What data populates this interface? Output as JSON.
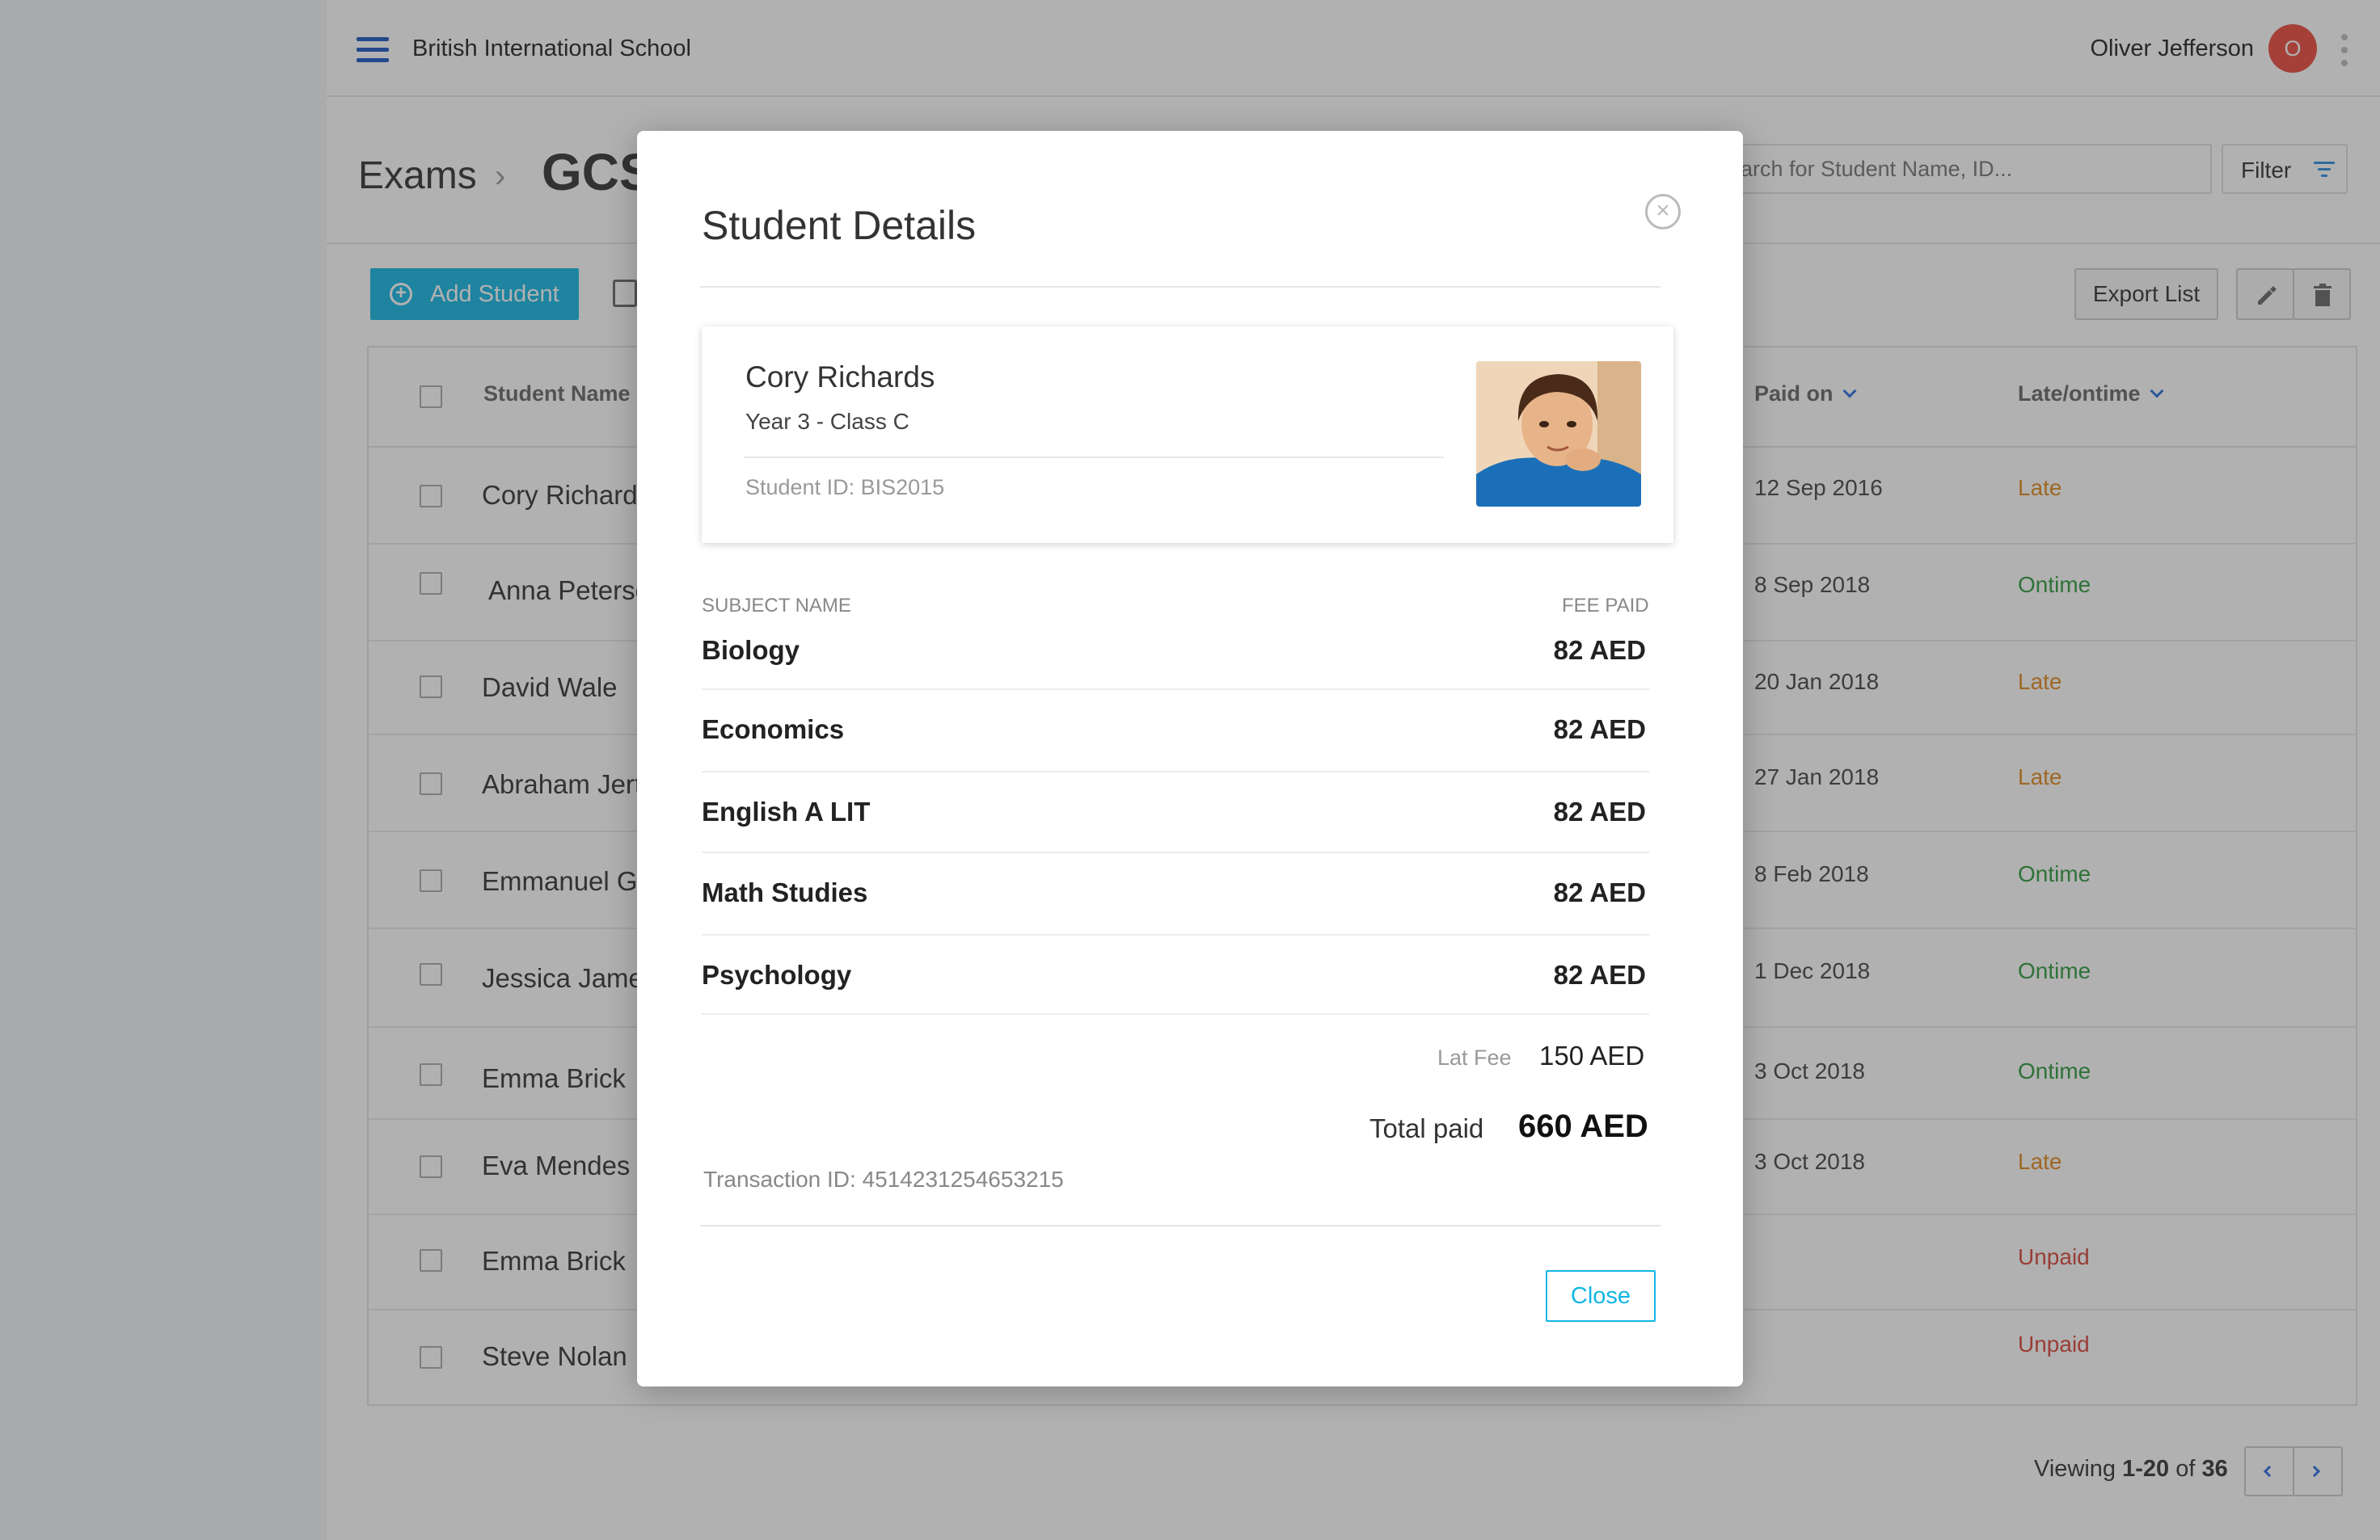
{
  "app": {
    "school_name": "British International School",
    "user_name": "Oliver Jefferson",
    "user_initial": "O"
  },
  "breadcrumb": {
    "root": "Exams",
    "current": "GCSE"
  },
  "search": {
    "placeholder": "Search for Student Name, ID..."
  },
  "toolbar": {
    "add_student": "Add Student",
    "filter": "Filter",
    "export_list": "Export List"
  },
  "table": {
    "columns": {
      "student_name": "Student Name",
      "paid_on": "Paid on",
      "late_ontime": "Late/ontime"
    },
    "rows": [
      {
        "name": "Cory Richards",
        "paid_on": "12 Sep 2016",
        "status": "Late"
      },
      {
        "name": "Anna Peterson",
        "paid_on": "8 Sep 2018",
        "status": "Ontime"
      },
      {
        "name": "David Wale",
        "paid_on": "20 Jan 2018",
        "status": "Late"
      },
      {
        "name": "Abraham Jert",
        "paid_on": "27 Jan 2018",
        "status": "Late"
      },
      {
        "name": "Emmanuel Go",
        "paid_on": "8 Feb 2018",
        "status": "Ontime"
      },
      {
        "name": "Jessica James",
        "paid_on": "1 Dec 2018",
        "status": "Ontime"
      },
      {
        "name": "Emma Brick",
        "paid_on": "3 Oct 2018",
        "status": "Ontime"
      },
      {
        "name": "Eva Mendes",
        "paid_on": "3 Oct 2018",
        "status": "Late"
      },
      {
        "name": "Emma Brick",
        "paid_on": "",
        "status": "Unpaid"
      },
      {
        "name": "Steve Nolan",
        "paid_on": "",
        "status": "Unpaid"
      }
    ]
  },
  "pagination": {
    "prefix": "Viewing ",
    "range": "1-20",
    "of": " of ",
    "total": "36"
  },
  "modal": {
    "title": "Student Details",
    "student": {
      "name": "Cory Richards",
      "class": "Year 3 - Class C",
      "student_id": "Student ID: BIS2015"
    },
    "subject_header": "SUBJECT NAME",
    "fee_header": "FEE PAID",
    "subjects": [
      {
        "name": "Biology",
        "fee": "82 AED"
      },
      {
        "name": "Economics",
        "fee": "82 AED"
      },
      {
        "name": "English A LIT",
        "fee": "82 AED"
      },
      {
        "name": "Math Studies",
        "fee": "82 AED"
      },
      {
        "name": "Psychology",
        "fee": "82 AED"
      }
    ],
    "late_fee_label": "Lat Fee",
    "late_fee_value": "150 AED",
    "total_label": "Total paid",
    "total_value": "660 AED",
    "transaction": "Transaction ID: 4514231254653215",
    "close": "Close"
  },
  "colors": {
    "accent": "#12b6e3",
    "late": "#e08a1e",
    "ontime": "#2e9a3e",
    "unpaid": "#d9453a",
    "avatar": "#ea4a3c",
    "link": "#2a6ee0"
  },
  "icons": [
    "menu-icon",
    "more-vert-icon",
    "filter-icon",
    "add-circle-icon",
    "upload-icon",
    "edit-icon",
    "delete-icon",
    "chevron-down-icon",
    "close-circle-icon",
    "chevron-left-icon",
    "chevron-right-icon"
  ]
}
